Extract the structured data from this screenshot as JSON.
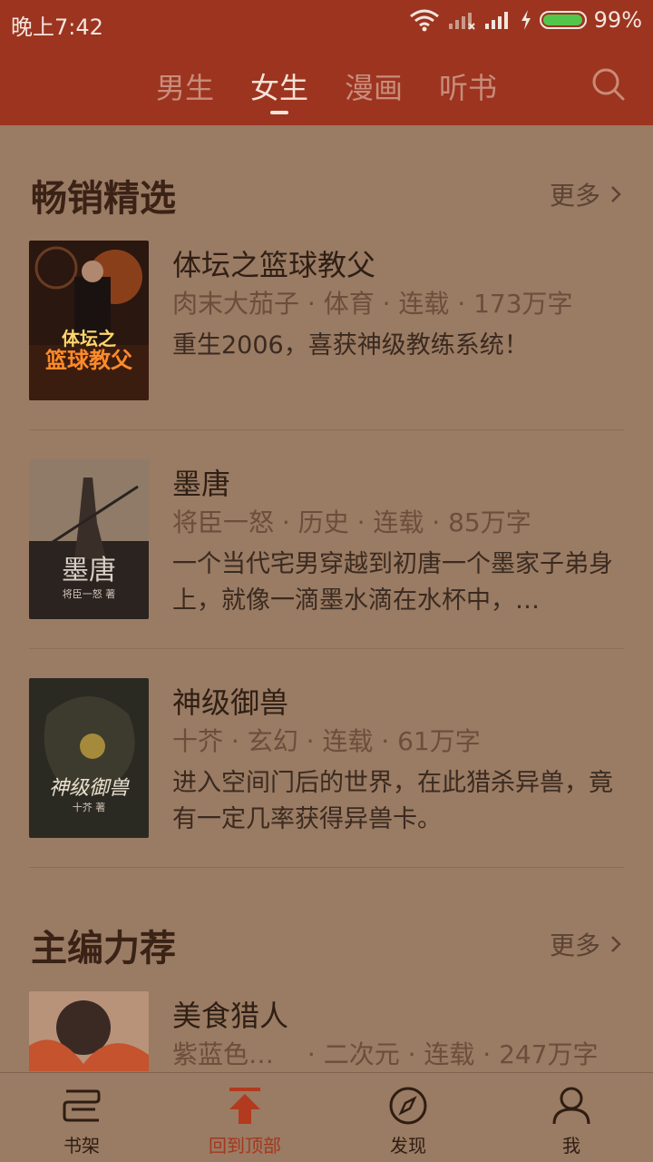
{
  "status": {
    "time": "晚上7:42",
    "battery": "99%",
    "battery_level": 0.99,
    "battery_color": "#52c64b"
  },
  "tabs": [
    {
      "label": "男生",
      "active": false
    },
    {
      "label": "女生",
      "active": true
    },
    {
      "label": "漫画",
      "active": false
    },
    {
      "label": "听书",
      "active": false
    }
  ],
  "sections": [
    {
      "title": "畅销精选",
      "more": "更多",
      "books": [
        {
          "title": "体坛之篮球教父",
          "meta": "肉末大茄子 · 体育 · 连载 · 173万字",
          "desc": "重生2006，喜获神级教练系统！"
        },
        {
          "title": "墨唐",
          "meta": "将臣一怒 · 历史 · 连载 · 85万字",
          "desc": "一个当代宅男穿越到初唐一个墨家子弟身上，就像一滴墨水滴在水杯中，…"
        },
        {
          "title": "神级御兽",
          "meta": "十芥 · 玄幻 · 连载 · 61万字",
          "desc": "进入空间门后的世界，在此猎杀异兽，竟有一定几率获得异兽卡。"
        }
      ]
    },
    {
      "title": "主编力荐",
      "more": "更多",
      "books": [
        {
          "title": "美食猎人",
          "meta": "紫蓝色…　 · 二次元 · 连载 · 247万字",
          "desc": ""
        }
      ]
    }
  ],
  "bottom_nav": [
    {
      "label": "书架",
      "icon": "bookshelf-icon",
      "active": false
    },
    {
      "label": "回到顶部",
      "icon": "arrow-up-icon",
      "active": true
    },
    {
      "label": "发现",
      "icon": "compass-icon",
      "active": false
    },
    {
      "label": "我",
      "icon": "user-icon",
      "active": false
    }
  ],
  "colors": {
    "header": "#9c3420",
    "background": "#9a7b63",
    "accent": "#a3381f"
  }
}
